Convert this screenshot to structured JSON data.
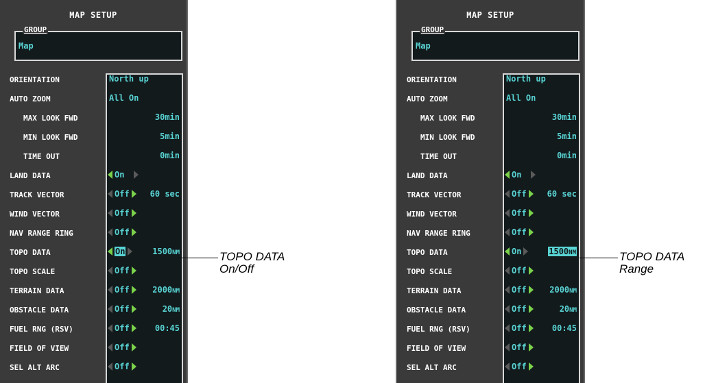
{
  "panels": [
    {
      "title": "MAP SETUP",
      "group_label": "GROUP",
      "group_value": "Map",
      "rows": [
        {
          "label": "ORIENTATION",
          "value": "North up"
        },
        {
          "label": "AUTO ZOOM",
          "value": "All On"
        },
        {
          "label": "MAX LOOK FWD",
          "range": "30min"
        },
        {
          "label": "MIN LOOK FWD",
          "range": "5min"
        },
        {
          "label": "TIME OUT",
          "range": "0min"
        },
        {
          "label": "LAND DATA",
          "value": "On"
        },
        {
          "label": "TRACK VECTOR",
          "value": "Off",
          "range": "60 sec"
        },
        {
          "label": "WIND VECTOR",
          "value": "Off"
        },
        {
          "label": "NAV RANGE RING",
          "value": "Off"
        },
        {
          "label": "TOPO DATA",
          "value": "On",
          "range": "1500",
          "range_unit": "NM"
        },
        {
          "label": "TOPO SCALE",
          "value": "Off"
        },
        {
          "label": "TERRAIN DATA",
          "value": "Off",
          "range": "2000",
          "range_unit": "NM"
        },
        {
          "label": "OBSTACLE DATA",
          "value": "Off",
          "range": "20",
          "range_unit": "NM"
        },
        {
          "label": "FUEL RNG (RSV)",
          "value": "Off",
          "range": "00:45"
        },
        {
          "label": "FIELD OF VIEW",
          "value": "Off"
        },
        {
          "label": "SEL ALT ARC",
          "value": "Off"
        }
      ],
      "callout": "TOPO DATA\nOn/Off",
      "selected_field": "TOPO DATA value"
    },
    {
      "title": "MAP SETUP",
      "group_label": "GROUP",
      "group_value": "Map",
      "rows": [
        {
          "label": "ORIENTATION",
          "value": "North up"
        },
        {
          "label": "AUTO ZOOM",
          "value": "All On"
        },
        {
          "label": "MAX LOOK FWD",
          "range": "30min"
        },
        {
          "label": "MIN LOOK FWD",
          "range": "5min"
        },
        {
          "label": "TIME OUT",
          "range": "0min"
        },
        {
          "label": "LAND DATA",
          "value": "On"
        },
        {
          "label": "TRACK VECTOR",
          "value": "Off",
          "range": "60 sec"
        },
        {
          "label": "WIND VECTOR",
          "value": "Off"
        },
        {
          "label": "NAV RANGE RING",
          "value": "Off"
        },
        {
          "label": "TOPO DATA",
          "value": "On",
          "range": "1500",
          "range_unit": "NM"
        },
        {
          "label": "TOPO SCALE",
          "value": "Off"
        },
        {
          "label": "TERRAIN DATA",
          "value": "Off",
          "range": "2000",
          "range_unit": "NM"
        },
        {
          "label": "OBSTACLE DATA",
          "value": "Off",
          "range": "20",
          "range_unit": "NM"
        },
        {
          "label": "FUEL RNG (RSV)",
          "value": "Off",
          "range": "00:45"
        },
        {
          "label": "FIELD OF VIEW",
          "value": "Off"
        },
        {
          "label": "SEL ALT ARC",
          "value": "Off"
        }
      ],
      "callout": "TOPO DATA\nRange",
      "selected_field": "TOPO DATA range"
    }
  ],
  "colors": {
    "panel_bg": "#3a3a3a",
    "value_cyan": "#59d3d3",
    "arrow_green": "#7bd14a",
    "field_bg": "#121a1c"
  }
}
